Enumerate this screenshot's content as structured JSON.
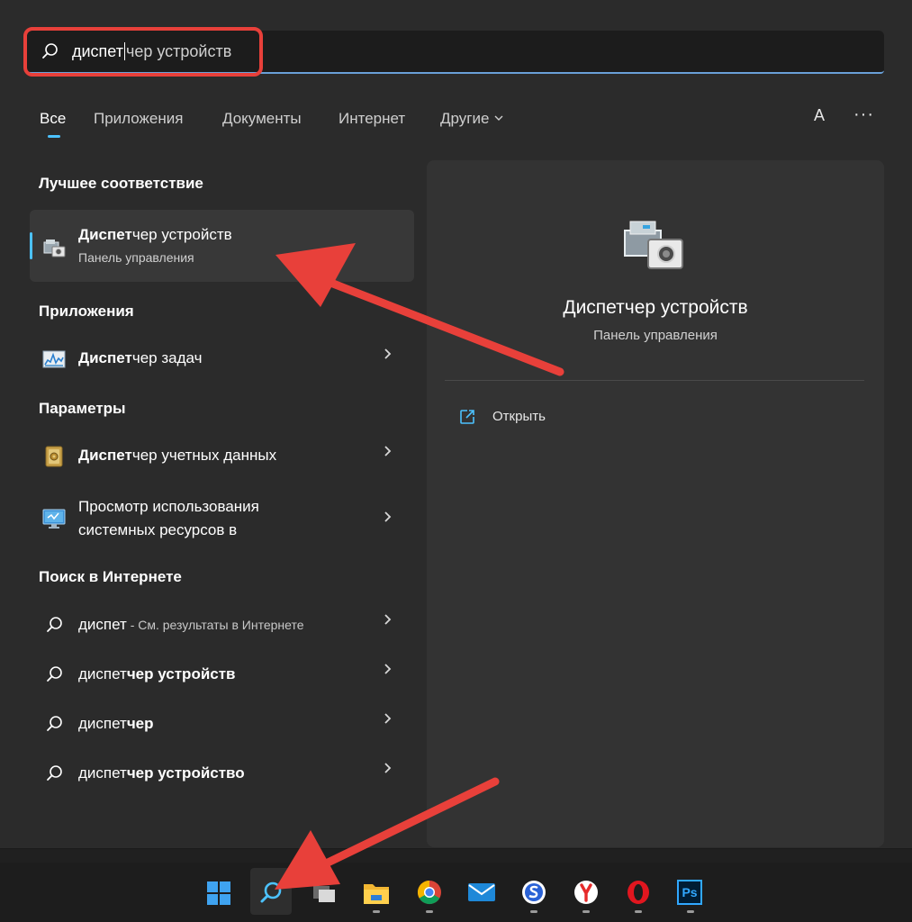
{
  "search": {
    "typed": "диспет",
    "completion": "чер устройств"
  },
  "tabs": [
    {
      "label": "Все"
    },
    {
      "label": "Приложения"
    },
    {
      "label": "Документы"
    },
    {
      "label": "Интернет"
    },
    {
      "label": "Другие"
    }
  ],
  "header": {
    "avatar_letter": "A",
    "more_label": "···"
  },
  "sections": {
    "best_match": "Лучшее соответствие",
    "apps": "Приложения",
    "settings": "Параметры",
    "web": "Поиск в Интернете"
  },
  "best_match": {
    "title_bold": "Диспет",
    "title_rest": "чер устройств",
    "subtitle": "Панель управления"
  },
  "apps": [
    {
      "bold": "Диспет",
      "rest": "чер задач"
    }
  ],
  "settings": [
    {
      "bold": "Диспет",
      "rest": "чер учетных данных"
    },
    {
      "line1": "Просмотр использования",
      "line2": "системных ресурсов в"
    }
  ],
  "web": [
    {
      "main": "диспет",
      "suffix": " - См. результаты в Интернете"
    },
    {
      "main": "диспет",
      "bold": "чер устройств"
    },
    {
      "main": "диспет",
      "bold": "чер"
    },
    {
      "main": "диспет",
      "bold": "чер устройство"
    }
  ],
  "preview": {
    "title": "Диспетчер устройств",
    "subtitle": "Панель управления",
    "open_label": "Открыть"
  },
  "taskbar": {
    "icons": [
      "windows-start-icon",
      "search-icon",
      "task-view-icon",
      "file-explorer-icon",
      "chrome-icon",
      "mail-icon",
      "skype-like-icon",
      "yandex-browser-icon",
      "opera-icon",
      "photoshop-icon"
    ],
    "ps_label": "Ps"
  },
  "colors": {
    "accent": "#4cc2ff",
    "annotation": "#e8403a",
    "panel": "#2b2b2b"
  }
}
